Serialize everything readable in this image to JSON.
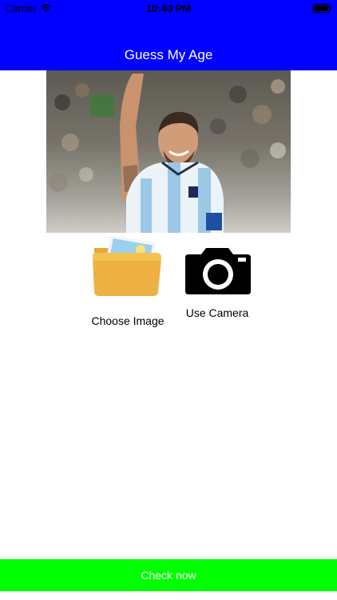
{
  "status_bar": {
    "carrier": "Carrier",
    "time": "10:40 PM",
    "wifi_icon": "wifi-icon",
    "battery_icon": "battery-icon"
  },
  "nav": {
    "title": "Guess My Age",
    "background": "#0000ff"
  },
  "photo": {
    "subject": "photo-of-smiling-soccer-player"
  },
  "options": {
    "choose_image": {
      "label": "Choose Image",
      "icon": "folder-icon"
    },
    "use_camera": {
      "label": "Use Camera",
      "icon": "camera-icon"
    }
  },
  "check_button": {
    "label": "Check now",
    "background": "#00ff00"
  }
}
